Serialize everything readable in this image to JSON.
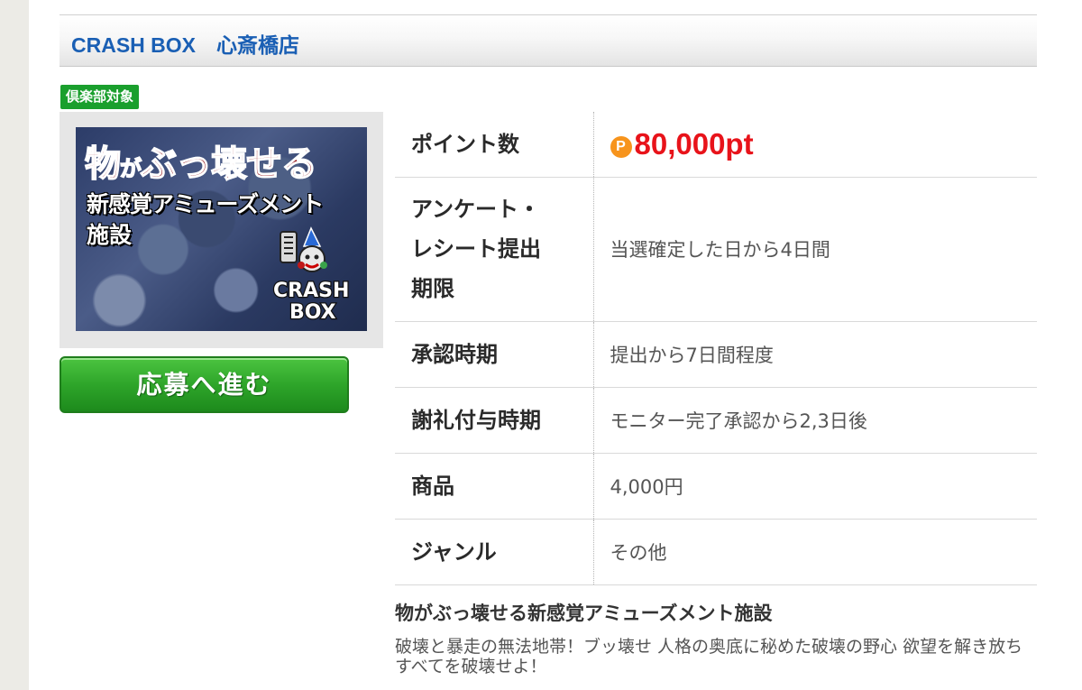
{
  "header": {
    "title": "CRASH BOX　心斎橋店"
  },
  "badge": {
    "label": "倶楽部対象"
  },
  "banner": {
    "line1_a": "物",
    "line1_b": "が",
    "line1_c": "ぶっ壊せる",
    "line2": "新感覚アミューズメント",
    "line3": "施設",
    "logo_text": "CRASH BOX"
  },
  "apply_button": {
    "label": "応募へ進む"
  },
  "details": {
    "points_icon": "P",
    "rows": [
      {
        "label": "ポイント数",
        "value": "80,000pt"
      },
      {
        "label_lines": [
          "アンケート・",
          "レシート提出",
          "期限"
        ],
        "value": "当選確定した日から4日間"
      },
      {
        "label": "承認時期",
        "value": "提出から7日間程度"
      },
      {
        "label": "謝礼付与時期",
        "value": "モニター完了承認から2,3日後"
      },
      {
        "label": "商品",
        "value": "4,000円"
      },
      {
        "label": "ジャンル",
        "value": "その他"
      }
    ]
  },
  "description": {
    "title": "物がぶっ壊せる新感覚アミューズメント施設",
    "body": "破壊と暴走の無法地帯！ブッ壊せ 人格の奥底に秘めた破壊の野心 欲望を解き放ちすべてを破壊せよ！"
  },
  "colors": {
    "title_blue": "#1a5fb4",
    "badge_green": "#1a9f2d",
    "button_green": "#2ea52a",
    "points_red": "#e8131a",
    "points_icon_orange": "#f7941d"
  }
}
